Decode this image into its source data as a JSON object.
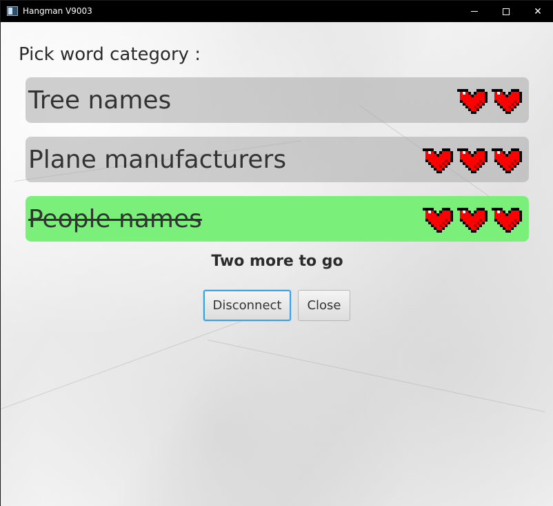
{
  "window": {
    "title": "Hangman V9003",
    "icon": "app-window-icon",
    "controls": {
      "minimize": "minimize-icon",
      "maximize": "maximize-icon",
      "close": "✕"
    }
  },
  "heading": "Pick word category :",
  "categories": [
    {
      "label": "Tree names",
      "hearts": 2,
      "completed": false
    },
    {
      "label": "Plane manufacturers",
      "hearts": 3,
      "completed": false
    },
    {
      "label": "People names",
      "hearts": 3,
      "completed": true
    }
  ],
  "status": "Two more to go",
  "buttons": {
    "disconnect": "Disconnect",
    "close": "Close"
  },
  "colors": {
    "category_bg": "#aaaaaa",
    "category_done_bg": "#7af07a",
    "heart": "#ff0000",
    "focus_border": "#3aa0e0"
  }
}
